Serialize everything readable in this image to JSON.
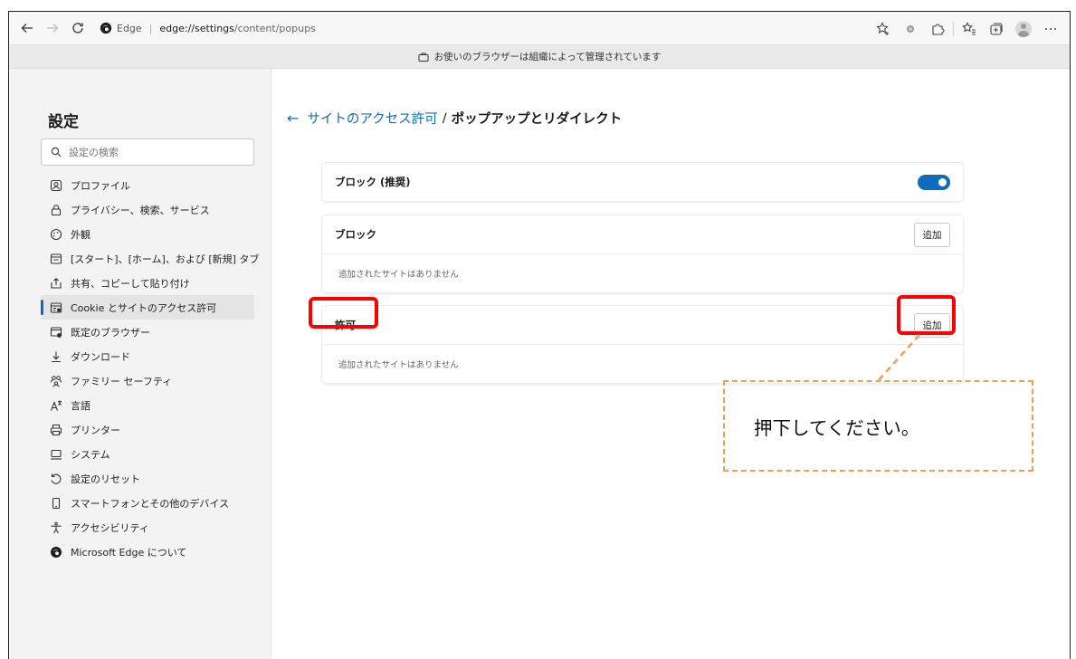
{
  "browser": {
    "site_label": "Edge",
    "url_host": "edge://settings",
    "url_path": "/content/popups"
  },
  "managed_bar": {
    "text": "お使いのブラウザーは組織によって管理されています"
  },
  "sidebar": {
    "title": "設定",
    "search_placeholder": "設定の検索",
    "items": [
      {
        "label": "プロファイル",
        "icon": "profile-icon"
      },
      {
        "label": "プライバシー、検索、サービス",
        "icon": "lock-icon"
      },
      {
        "label": "外観",
        "icon": "appearance-icon"
      },
      {
        "label": "[スタート]、[ホーム]、および [新規] タブ",
        "icon": "home-tab-icon"
      },
      {
        "label": "共有、コピーして貼り付け",
        "icon": "share-icon"
      },
      {
        "label": "Cookie とサイトのアクセス許可",
        "icon": "cookie-icon",
        "active": true
      },
      {
        "label": "既定のブラウザー",
        "icon": "default-browser-icon"
      },
      {
        "label": "ダウンロード",
        "icon": "download-icon"
      },
      {
        "label": "ファミリー セーフティ",
        "icon": "family-icon"
      },
      {
        "label": "言語",
        "icon": "language-icon"
      },
      {
        "label": "プリンター",
        "icon": "printer-icon"
      },
      {
        "label": "システム",
        "icon": "system-icon"
      },
      {
        "label": "設定のリセット",
        "icon": "reset-icon"
      },
      {
        "label": "スマートフォンとその他のデバイス",
        "icon": "phone-icon"
      },
      {
        "label": "アクセシビリティ",
        "icon": "accessibility-icon"
      },
      {
        "label": "Microsoft Edge について",
        "icon": "edge-logo-icon"
      }
    ]
  },
  "breadcrumb": {
    "parent": "サイトのアクセス許可",
    "separator": "/",
    "current": "ポップアップとリダイレクト"
  },
  "block_toggle": {
    "label": "ブロック (推奨)",
    "enabled": true
  },
  "block_section": {
    "label": "ブロック",
    "add_label": "追加",
    "empty_text": "追加されたサイトはありません"
  },
  "allow_section": {
    "label": "許可",
    "add_label": "追加",
    "empty_text": "追加されたサイトはありません"
  },
  "callout": {
    "text": "押下してください。"
  },
  "colors": {
    "accent": "#0f6cbd",
    "highlight": "#ff0000",
    "callout_border": "#f0a04b"
  }
}
